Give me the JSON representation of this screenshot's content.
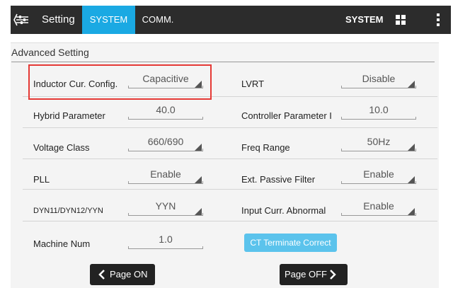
{
  "header": {
    "title": "Setting",
    "tabs": [
      {
        "label": "SYSTEM",
        "active": true
      },
      {
        "label": "COMM.",
        "active": false
      }
    ],
    "system_label": "SYSTEM",
    "icons": [
      "back-icon",
      "grid-icon",
      "more-vertical-icon"
    ],
    "accent_color": "#1aa9e3",
    "bar_color": "#2c2c2c"
  },
  "section": {
    "title": "Advanced Setting"
  },
  "params": {
    "inductor": {
      "label": "Inductor Cur. Config.",
      "value": "Capacitive"
    },
    "lvrt": {
      "label": "LVRT",
      "value": "Disable"
    },
    "hybrid": {
      "label": "Hybrid Parameter",
      "value": "40.0"
    },
    "controller": {
      "label": "Controller Parameter I",
      "value": "10.0"
    },
    "voltage": {
      "label": "Voltage Class",
      "value": "660/690"
    },
    "freq": {
      "label": "Freq Range",
      "value": "50Hz"
    },
    "pll": {
      "label": "PLL",
      "value": "Enable"
    },
    "passive": {
      "label": "Ext. Passive Filter",
      "value": "Enable"
    },
    "dyn": {
      "label": "DYN11/DYN12/YYN",
      "value": "YYN"
    },
    "input_curr": {
      "label": "Input Curr. Abnormal",
      "value": "Enable"
    },
    "machine": {
      "label": "Machine Num",
      "value": "1.0"
    }
  },
  "ct_button": {
    "label": "CT Terminate Correct"
  },
  "pager": {
    "prev_label": "Page ON",
    "next_label": "Page OFF"
  },
  "highlight_color": "#e53935"
}
